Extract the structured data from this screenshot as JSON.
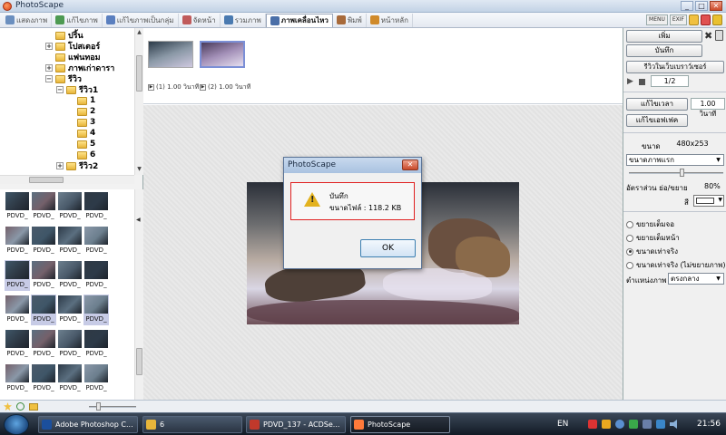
{
  "window": {
    "title": "PhotoScape",
    "controls": [
      "_",
      "□",
      "✕"
    ]
  },
  "tabs": [
    {
      "label": "แสดงภาพ",
      "icon": "viewer-icon",
      "color": "#6b8fbf"
    },
    {
      "label": "แก้ไขภาพ",
      "icon": "editor-icon",
      "color": "#4d9a52"
    },
    {
      "label": "แก้ไขภาพเป็นกลุ่ม",
      "icon": "batch-editor-icon",
      "color": "#5a7fbf"
    },
    {
      "label": "จัดหน้า",
      "icon": "page-icon",
      "color": "#c05a5a"
    },
    {
      "label": "รวมภาพ",
      "icon": "combine-icon",
      "color": "#4a7ab0"
    },
    {
      "label": "ภาพเคลื่อนไหว",
      "icon": "animated-gif-icon",
      "color": "#4a6fa8"
    },
    {
      "label": "พิมพ์",
      "icon": "print-icon",
      "color": "#a86a3a"
    },
    {
      "label": "หน้าหลัก",
      "icon": "home-icon",
      "color": "#d08a2a"
    }
  ],
  "active_tab": 5,
  "toolbar_right": {
    "chip1": "MENU",
    "chip2": "EXIF"
  },
  "tree": [
    {
      "label": "ปริ้น",
      "level": 0,
      "expander": ""
    },
    {
      "label": "โปสเตอร์",
      "level": 0,
      "expander": "+"
    },
    {
      "label": "แฟนทอม",
      "level": 0,
      "expander": ""
    },
    {
      "label": "ภาพเก่าดารา",
      "level": 0,
      "expander": "+"
    },
    {
      "label": "รีวิว",
      "level": 0,
      "expander": "−"
    },
    {
      "label": "รีวิว1",
      "level": 1,
      "expander": "−"
    },
    {
      "label": "1",
      "level": 2,
      "expander": ""
    },
    {
      "label": "2",
      "level": 2,
      "expander": ""
    },
    {
      "label": "3",
      "level": 2,
      "expander": ""
    },
    {
      "label": "4",
      "level": 2,
      "expander": ""
    },
    {
      "label": "5",
      "level": 2,
      "expander": ""
    },
    {
      "label": "6",
      "level": 2,
      "expander": ""
    },
    {
      "label": "รีวิว2",
      "level": 1,
      "expander": "+"
    }
  ],
  "thumbnails": {
    "caption": "PDVD_",
    "rows": 6,
    "cols": 4,
    "selected": [
      8,
      13,
      15
    ]
  },
  "filmstrip": {
    "frames": [
      {
        "caption": "(1) 1.00 วินาที"
      },
      {
        "caption": "(2) 1.00 วินาที"
      }
    ]
  },
  "right": {
    "add": "เพิ่ม",
    "save": "บันทึก",
    "preview": "รีวิวในเว็บเบราว์เซอร์",
    "page": "1/2",
    "edit_time": "แก้ไขเวลา",
    "time_value": "1.00 วินาที",
    "edit_effect": "แก้ไขเอฟเฟค",
    "size_label": "ขนาด",
    "size_value": "480x253",
    "size_select": "ขนาดภาพแรก",
    "ratio_label": "อัตราส่วน ย่อ/ขยาย",
    "ratio_value": "80%",
    "color_label": "สี",
    "fit_options": [
      {
        "label": "ขยายเต็มจอ",
        "checked": false
      },
      {
        "label": "ขยายเต็มหน้า",
        "checked": false
      },
      {
        "label": "ขนาดเท่าจริง",
        "checked": true
      },
      {
        "label": "ขนาดเท่าจริง (ไม่ขยายภาพ)",
        "checked": false
      }
    ],
    "position_label": "ตำแหน่งภาพ",
    "position_value": "ตรงกลาง"
  },
  "dialog": {
    "title": "PhotoScape",
    "line1": "บันทึก",
    "line2": "ขนาดไฟล์ : 118.2 KB",
    "ok": "OK"
  },
  "taskbar": {
    "items": [
      {
        "label": "Adobe Photoshop C...",
        "color": "#1b4f9c"
      },
      {
        "label": "6",
        "color": "#e7b53a"
      },
      {
        "label": "PDVD_137 - ACDSe...",
        "color": "#c0392b"
      },
      {
        "label": "PhotoScape",
        "color": "#ff7a3a"
      }
    ],
    "active": 3,
    "lang": "EN",
    "clock": "21:56"
  }
}
